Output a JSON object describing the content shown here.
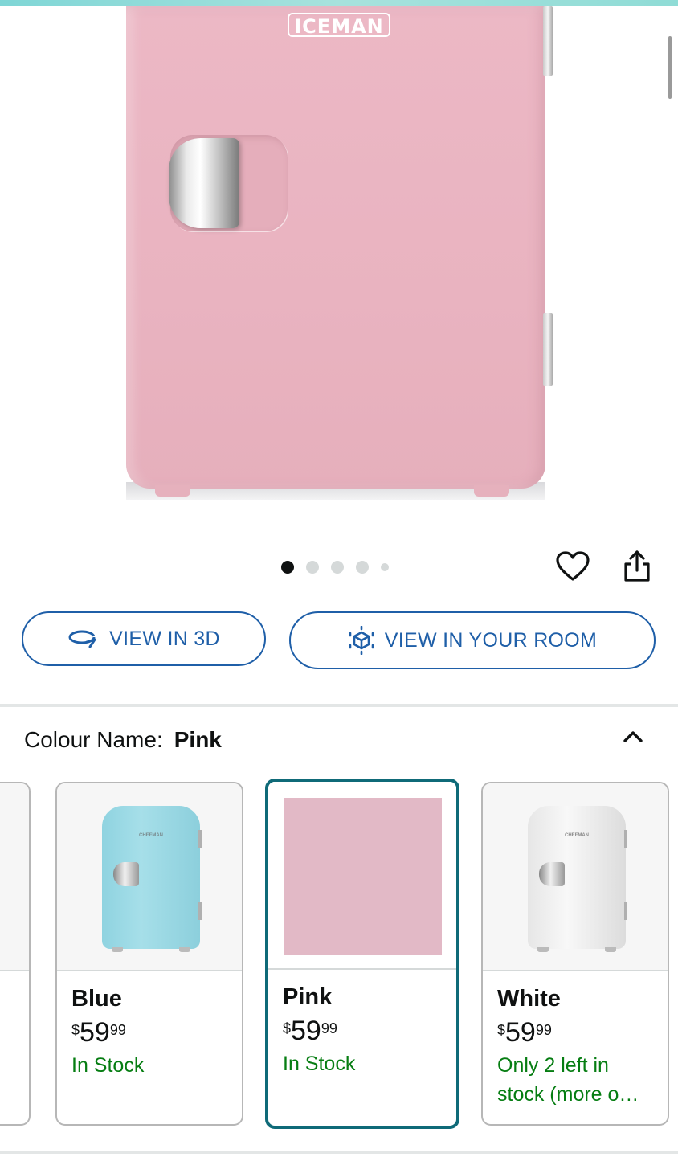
{
  "hero": {
    "brand_logo": "ICEMAN",
    "carousel": {
      "total": 5,
      "active_index": 0
    }
  },
  "actions": {
    "favorite_icon": "heart-icon",
    "share_icon": "share-icon"
  },
  "view_buttons": {
    "view_3d": {
      "label": "VIEW IN 3D",
      "icon": "rotate-3d-icon"
    },
    "view_room": {
      "label": "VIEW IN YOUR ROOM",
      "icon": "ar-cube-icon"
    }
  },
  "colour": {
    "label": "Colour Name:",
    "selected": "Pink",
    "toggle_icon": "chevron-up-icon",
    "options": [
      {
        "name": "Blue",
        "currency": "$",
        "whole": "59",
        "fraction": "99",
        "stock": "In Stock",
        "mini_logo": "CHEFMAN"
      },
      {
        "name": "Pink",
        "currency": "$",
        "whole": "59",
        "fraction": "99",
        "stock": "In Stock",
        "swatch_color": "#e2b9c6"
      },
      {
        "name": "White",
        "currency": "$",
        "whole": "59",
        "fraction": "99",
        "stock": "Only 2 left in stock (more o…",
        "mini_logo": "CHEFMAN"
      }
    ]
  },
  "colors": {
    "link_blue": "#1f5fa8",
    "selected_border": "#0f6a78",
    "stock_green": "#067d12",
    "fridge_pink": "#e9b3c0"
  }
}
